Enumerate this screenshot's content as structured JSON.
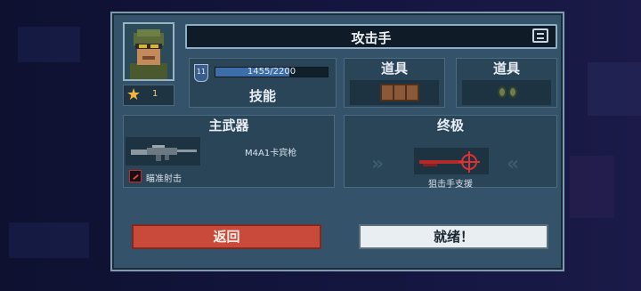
{
  "title": "攻击手",
  "rank": {
    "stars": 1
  },
  "skill": {
    "level": "11",
    "xp_text": "1455/2200",
    "xp_fraction": 0.661,
    "label": "技能"
  },
  "items": [
    {
      "label": "道具",
      "icon": "ammo-crate-icon"
    },
    {
      "label": "道具",
      "icon": "grenades-icon"
    }
  ],
  "primary_weapon": {
    "header": "主武器",
    "name": "M4A1卡宾枪",
    "skill": "瞄准射击"
  },
  "ultimate": {
    "header": "终极",
    "name": "狙击手支援"
  },
  "buttons": {
    "back": "返回",
    "ready": "就绪！"
  },
  "colors": {
    "panel": "#34536a",
    "back_button": "#c94a3a",
    "ready_button": "#e9eef2",
    "star": "#f3b53a",
    "xp": "#3d6ea8"
  }
}
